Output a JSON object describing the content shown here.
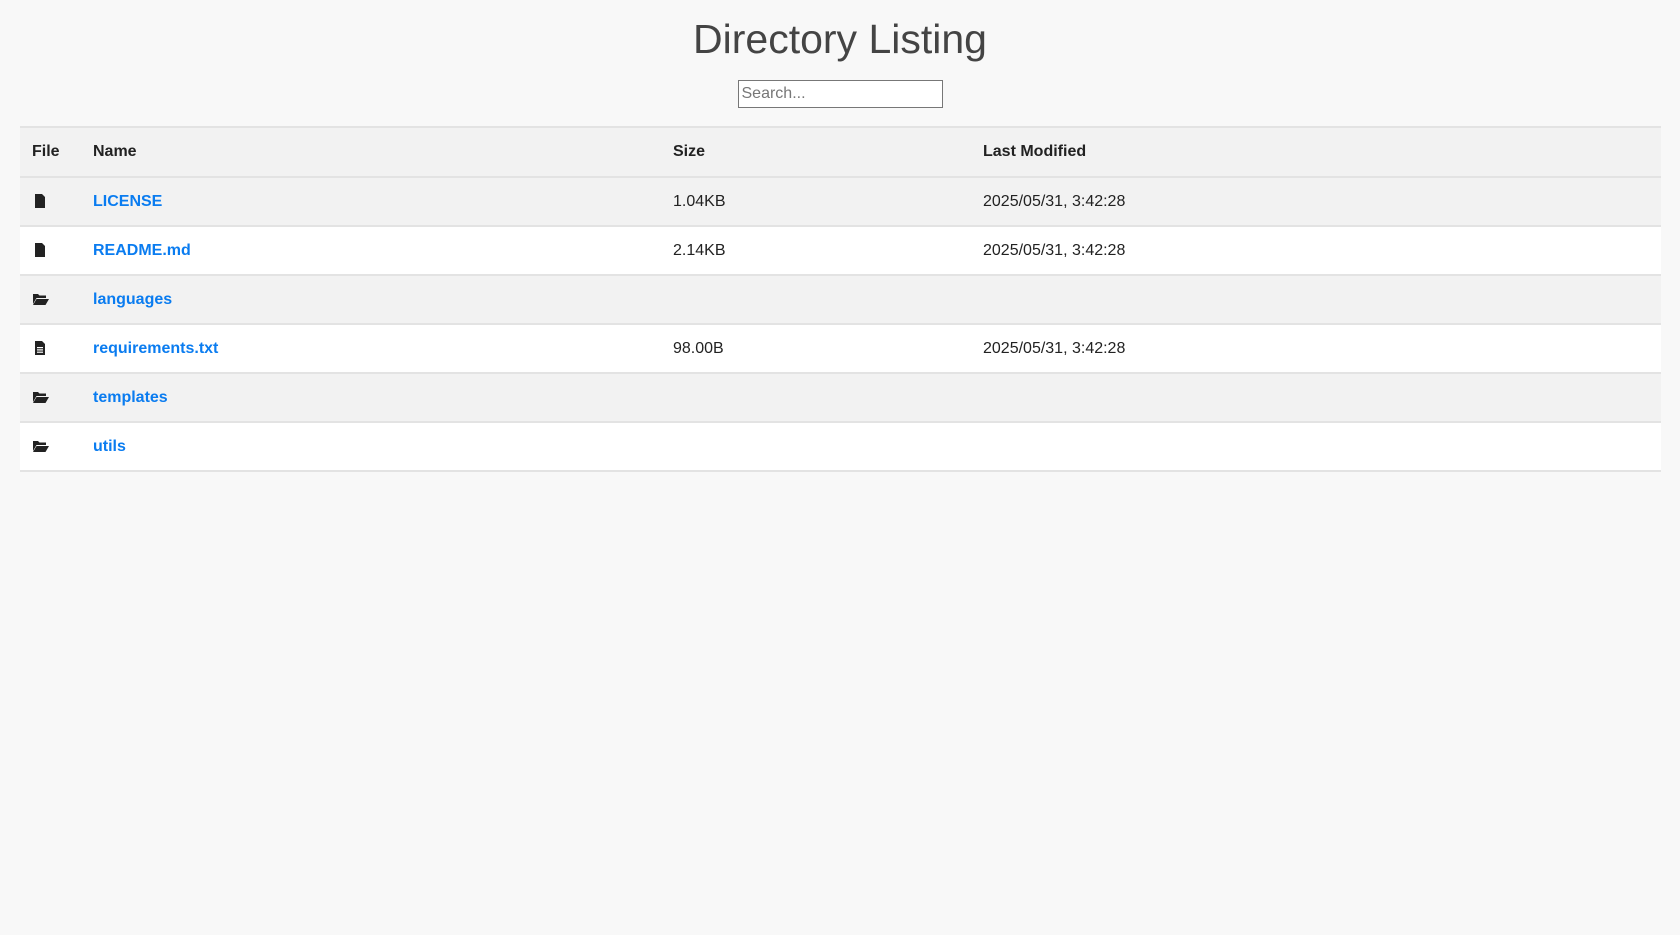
{
  "title": "Directory Listing",
  "search": {
    "placeholder": "Search...",
    "value": ""
  },
  "columns": {
    "file": "File",
    "name": "Name",
    "size": "Size",
    "modified": "Last Modified"
  },
  "rows": [
    {
      "type": "file",
      "icon": "file-icon",
      "name": "LICENSE",
      "size": "1.04KB",
      "modified": "2025/05/31, 3:42:28"
    },
    {
      "type": "file",
      "icon": "file-icon",
      "name": "README.md",
      "size": "2.14KB",
      "modified": "2025/05/31, 3:42:28"
    },
    {
      "type": "folder",
      "icon": "folder-open-icon",
      "name": "languages",
      "size": "",
      "modified": ""
    },
    {
      "type": "file-text",
      "icon": "file-text-icon",
      "name": "requirements.txt",
      "size": "98.00B",
      "modified": "2025/05/31, 3:42:28"
    },
    {
      "type": "folder",
      "icon": "folder-open-icon",
      "name": "templates",
      "size": "",
      "modified": ""
    },
    {
      "type": "folder",
      "icon": "folder-open-icon",
      "name": "utils",
      "size": "",
      "modified": ""
    }
  ]
}
